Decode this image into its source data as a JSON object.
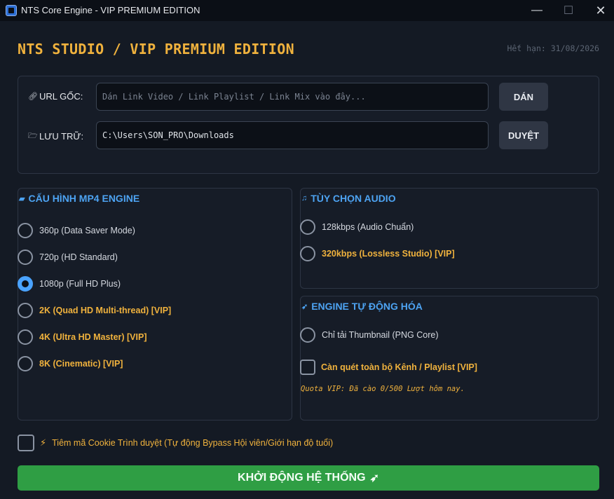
{
  "window": {
    "title": "NTS Core Engine - VIP PREMIUM EDITION",
    "icons": {
      "minimize": "—",
      "maximize": "☐",
      "close": "✕"
    }
  },
  "header": {
    "brand": "NTS STUDIO / VIP PREMIUM EDITION",
    "expiry": "Hết hạn: 31/08/2026"
  },
  "source": {
    "url_label": "URL GỐC:",
    "url_placeholder": "Dán Link Video / Link Playlist / Link Mix vào đây...",
    "url_value": "",
    "paste_button": "DÁN",
    "save_label": "LƯU TRỮ:",
    "save_path": "C:\\Users\\SON_PRO\\Downloads",
    "browse_button": "DUYỆT"
  },
  "mp4": {
    "title": "CẤU HÌNH MP4 ENGINE",
    "options": [
      {
        "label": "360p (Data Saver Mode)",
        "vip": false,
        "checked": false
      },
      {
        "label": "720p (HD Standard)",
        "vip": false,
        "checked": false
      },
      {
        "label": "1080p (Full HD Plus)",
        "vip": false,
        "checked": true
      },
      {
        "label": "2K (Quad HD Multi-thread) [VIP]",
        "vip": true,
        "checked": false
      },
      {
        "label": "4K (Ultra HD Master) [VIP]",
        "vip": true,
        "checked": false
      },
      {
        "label": "8K (Cinematic) [VIP]",
        "vip": true,
        "checked": false
      }
    ]
  },
  "audio": {
    "title": "TÙY CHỌN AUDIO",
    "options": [
      {
        "label": "128kbps (Audio Chuẩn)",
        "vip": false,
        "checked": false
      },
      {
        "label": "320kbps (Lossless Studio) [VIP]",
        "vip": true,
        "checked": false
      }
    ]
  },
  "engine": {
    "title": "ENGINE TỰ ĐỘNG HÓA",
    "thumbnail_option": "Chỉ tải Thumbnail (PNG Core)",
    "scan_option": "Càn quét toàn bộ Kênh / Playlist [VIP]",
    "quota": "Quota VIP: Đã cào 0/500 Lượt hôm nay."
  },
  "cookie": {
    "label": "Tiêm mã Cookie Trình duyệt (Tự động Bypass Hội viên/Giới hạn độ tuổi)",
    "checked": false
  },
  "start": {
    "label": "KHỞI ĐỘNG HỆ THỐNG"
  },
  "colors": {
    "accent_gold": "#f0b23d",
    "accent_blue": "#4da3f2",
    "start_green": "#2f9e44",
    "background": "#141a24"
  }
}
